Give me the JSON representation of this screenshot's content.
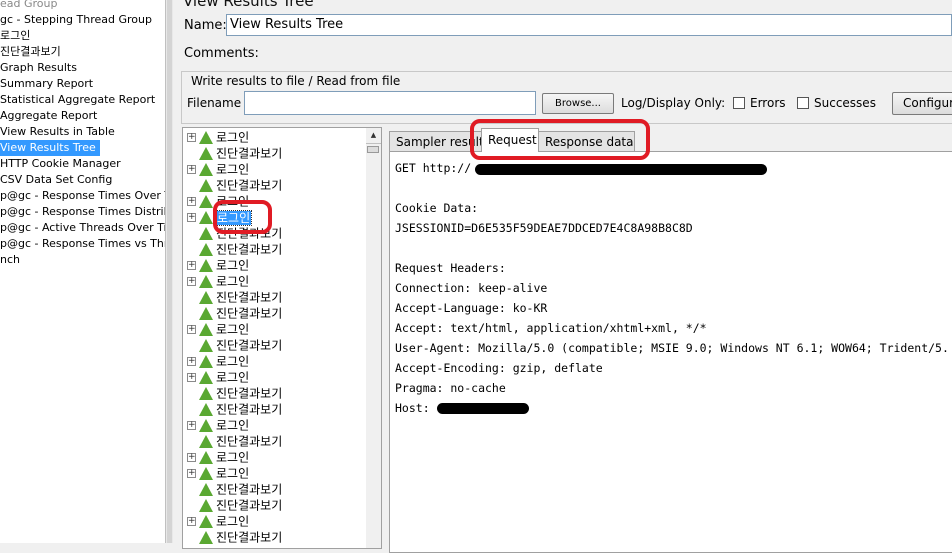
{
  "left_tree": [
    {
      "label": "ead Group",
      "gray": true
    },
    {
      "label": "gc - Stepping Thread Group"
    },
    {
      "label": "로그인"
    },
    {
      "label": "진단결과보기"
    },
    {
      "label": "Graph Results"
    },
    {
      "label": "Summary Report"
    },
    {
      "label": "Statistical Aggregate Report"
    },
    {
      "label": "Aggregate Report"
    },
    {
      "label": "View Results in Table"
    },
    {
      "label": "View Results Tree",
      "selected": true
    },
    {
      "label": "HTTP Cookie Manager"
    },
    {
      "label": "CSV Data Set Config"
    },
    {
      "label": "p@gc - Response Times Over Time"
    },
    {
      "label": "p@gc - Response Times Distribution"
    },
    {
      "label": "p@gc - Active Threads Over Time"
    },
    {
      "label": "p@gc - Response Times vs Threads"
    },
    {
      "label": "nch"
    }
  ],
  "header": {
    "title": "View Results Tree",
    "name_label": "Name:",
    "name_value": "View Results Tree",
    "comments_label": "Comments:"
  },
  "file_panel": {
    "legend": "Write results to file / Read from file",
    "filename_label": "Filename",
    "filename_value": "",
    "browse_label": "Browse...",
    "log_display_label": "Log/Display Only:",
    "errors_label": "Errors",
    "successes_label": "Successes",
    "configure_label": "Configure"
  },
  "result_tree": {
    "nodes": [
      {
        "label": "로그인",
        "top_level": true
      },
      {
        "label": "진단결과보기",
        "top_level": false
      },
      {
        "label": "로그인",
        "top_level": true
      },
      {
        "label": "진단결과보기",
        "top_level": false
      },
      {
        "label": "로그인",
        "top_level": true
      },
      {
        "label": "로그인",
        "top_level": true,
        "selected": true
      },
      {
        "label": "진단결과보기",
        "top_level": false
      },
      {
        "label": "진단결과보기",
        "top_level": false
      },
      {
        "label": "로그인",
        "top_level": true
      },
      {
        "label": "로그인",
        "top_level": true
      },
      {
        "label": "진단결과보기",
        "top_level": false
      },
      {
        "label": "진단결과보기",
        "top_level": false
      },
      {
        "label": "로그인",
        "top_level": true
      },
      {
        "label": "진단결과보기",
        "top_level": false
      },
      {
        "label": "로그인",
        "top_level": true
      },
      {
        "label": "로그인",
        "top_level": true
      },
      {
        "label": "진단결과보기",
        "top_level": false
      },
      {
        "label": "진단결과보기",
        "top_level": false
      },
      {
        "label": "로그인",
        "top_level": true
      },
      {
        "label": "진단결과보기",
        "top_level": false
      },
      {
        "label": "로그인",
        "top_level": true
      },
      {
        "label": "로그인",
        "top_level": true
      },
      {
        "label": "진단결과보기",
        "top_level": false
      },
      {
        "label": "진단결과보기",
        "top_level": false
      },
      {
        "label": "로그인",
        "top_level": true
      },
      {
        "label": "진단결과보기",
        "top_level": false
      }
    ]
  },
  "tabs": {
    "sampler": "Sampler result",
    "request": "Request",
    "response": "Response data"
  },
  "request_content": {
    "line1": "GET http://",
    "cookie_header": "Cookie Data:",
    "cookie_value": "JSESSIONID=D6E535F59DEAE7DDCED7E4C8A98B8C8D",
    "headers_title": "Request Headers:",
    "connection": "Connection: keep-alive",
    "accept_language": "Accept-Language: ko-KR",
    "accept": "Accept: text/html, application/xhtml+xml, */*",
    "user_agent": "User-Agent: Mozilla/5.0 (compatible; MSIE 9.0; Windows NT 6.1; WOW64; Trident/5.",
    "accept_encoding": "Accept-Encoding: gzip, deflate",
    "pragma": "Pragma: no-cache",
    "host": "Host: "
  },
  "colors": {
    "selection": "#3399ff",
    "highlight": "#e01b24",
    "success_icon": "#5aa832"
  }
}
